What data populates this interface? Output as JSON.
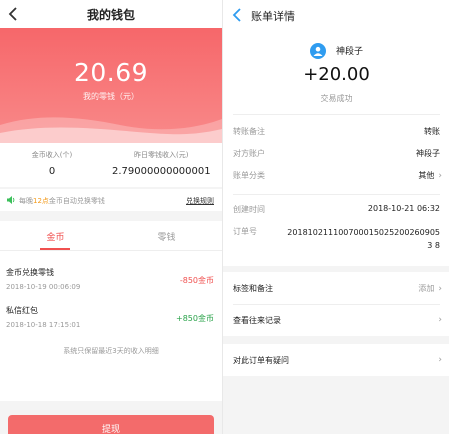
{
  "wallet": {
    "title": "我的钱包",
    "balance": "20.69",
    "balance_label": "我的零钱（元）",
    "coin_income_label": "金币收入(个)",
    "coin_income_value": "0",
    "yesterday_income_label": "昨日零钱收入(元)",
    "yesterday_income_value": "2.79000000000001",
    "notice_prefix": "每晚",
    "notice_highlight": "12点",
    "notice_suffix": "金币自动兑换零钱",
    "notice_link": "兑换规则",
    "tabs": [
      {
        "label": "金币"
      },
      {
        "label": "零钱"
      }
    ],
    "records": [
      {
        "name": "金币兑换零钱",
        "date": "2018-10-19 00:06:09",
        "amount": "-850金币"
      },
      {
        "name": "私信红包",
        "date": "2018-10-18 17:15:01",
        "amount": "+850金币"
      }
    ],
    "footnote": "系统只保留最近3天的收入明细",
    "withdraw_label": "提现"
  },
  "bill": {
    "title": "账单详情",
    "user_name": "神段子",
    "amount": "+20.00",
    "status": "交易成功",
    "details": [
      {
        "key": "转账备注",
        "value": "转账"
      },
      {
        "key": "对方账户",
        "value": "神段子"
      },
      {
        "key": "账单分类",
        "value": "其他"
      },
      {
        "key": "创建时间",
        "value": "2018-10-21 06:32"
      },
      {
        "key": "订单号",
        "value": "2018102111007000150252002609053 8"
      }
    ],
    "tags_label": "标签和备注",
    "tags_action": "添加",
    "history_label": "查看往来记录",
    "question_label": "对此订单有疑问"
  },
  "colors": {
    "accent_red": "#f0504f",
    "positive_green": "#2aa34a",
    "link_blue": "#2f9cf0"
  }
}
